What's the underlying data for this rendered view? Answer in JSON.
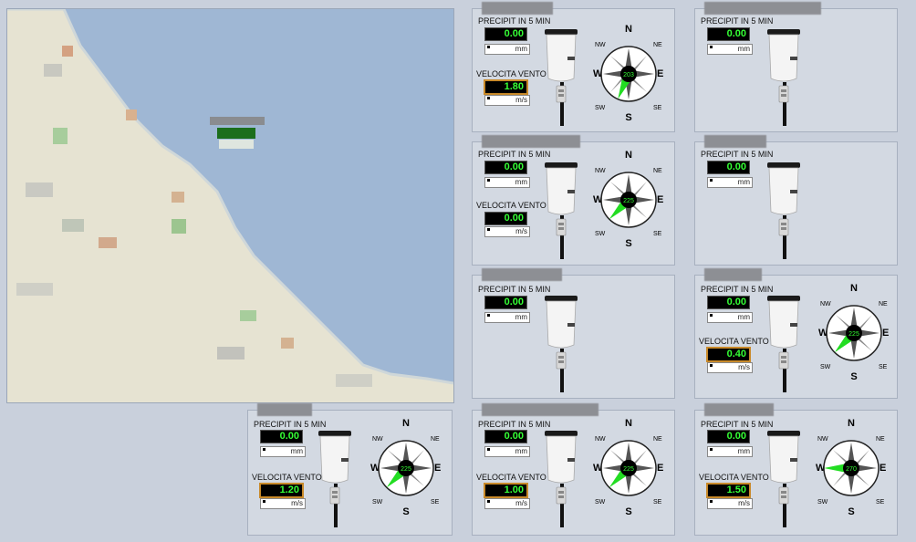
{
  "labels": {
    "rain": "PRECIPIT IN 5 MIN",
    "wind": "VELOCITA VENTO",
    "rain_unit": "mm",
    "wind_unit": "m/s",
    "n": "N",
    "s": "S",
    "e": "E",
    "w": "W",
    "ne": "NE",
    "nw": "NW",
    "se": "SE",
    "sw": "SW"
  },
  "colors": {
    "lcd_text": "#35ff35",
    "compass_needle": "#22dd22",
    "background": "#c9d0dc",
    "panel": "#d3d9e2"
  },
  "stations": [
    {
      "rain": "0.00",
      "wind": "1.80",
      "dir": "203"
    },
    {
      "rain": "0.00"
    },
    {
      "rain": "0.00",
      "wind": "0.00",
      "dir": "225"
    },
    {
      "rain": "0.00"
    },
    {
      "rain": "0.00"
    },
    {
      "rain": "0.00",
      "wind": "0.40",
      "dir": "225"
    },
    {
      "rain": "0.00",
      "wind": "1.20",
      "dir": "225"
    },
    {
      "rain": "0.00",
      "wind": "1.00",
      "dir": "225"
    },
    {
      "rain": "0.00",
      "wind": "1.50",
      "dir": "270"
    }
  ]
}
